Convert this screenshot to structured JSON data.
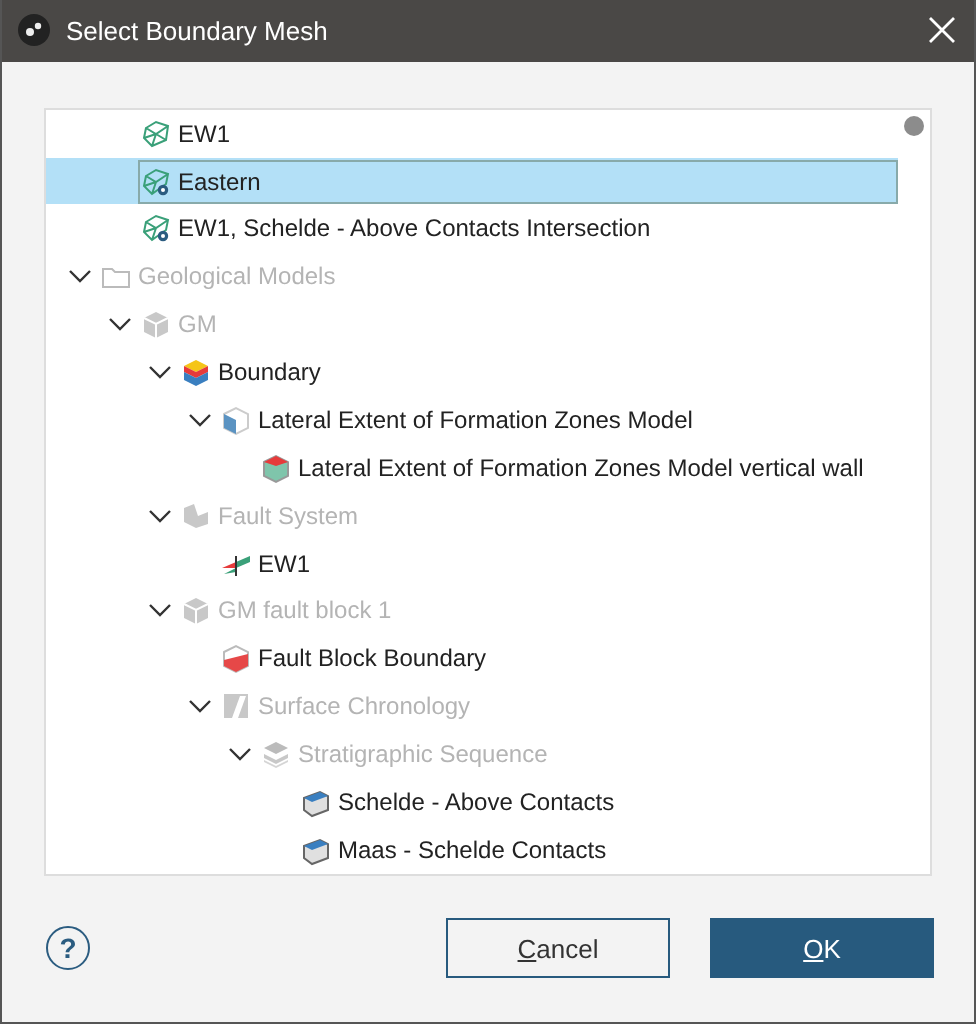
{
  "window": {
    "title": "Select Boundary Mesh"
  },
  "tree": {
    "continued_items": [
      {
        "label": "EW1",
        "kind": "mesh",
        "selected": false,
        "disabled": false
      },
      {
        "label": "Eastern",
        "kind": "mesh-gear",
        "selected": true,
        "disabled": false
      },
      {
        "label": "EW1, Schelde - Above Contacts Intersection",
        "kind": "mesh-gear",
        "selected": false,
        "disabled": false
      }
    ],
    "items": [
      {
        "label": "Geological Models",
        "kind": "folder",
        "selected": false,
        "disabled": true,
        "expanded": true,
        "children": [
          {
            "label": "GM",
            "kind": "model",
            "selected": false,
            "disabled": true,
            "expanded": true,
            "children": [
              {
                "label": "Boundary",
                "kind": "boundary",
                "selected": false,
                "disabled": false,
                "expanded": true,
                "children": [
                  {
                    "label": "Lateral Extent of Formation Zones Model",
                    "kind": "lateral",
                    "selected": false,
                    "disabled": false,
                    "expanded": true,
                    "children": [
                      {
                        "label": "Lateral Extent of Formation Zones Model vertical wall",
                        "kind": "wall",
                        "selected": false,
                        "disabled": false
                      }
                    ]
                  }
                ]
              },
              {
                "label": "Fault System",
                "kind": "fault-system",
                "selected": false,
                "disabled": true,
                "expanded": true,
                "children": [
                  {
                    "label": "EW1",
                    "kind": "fault",
                    "selected": false,
                    "disabled": false
                  }
                ]
              },
              {
                "label": "GM fault block 1",
                "kind": "model",
                "selected": false,
                "disabled": true,
                "expanded": true,
                "children": [
                  {
                    "label": "Fault Block Boundary",
                    "kind": "block-boundary",
                    "selected": false,
                    "disabled": false
                  },
                  {
                    "label": "Surface Chronology",
                    "kind": "chronology",
                    "selected": false,
                    "disabled": true,
                    "expanded": true,
                    "children": [
                      {
                        "label": "Stratigraphic Sequence",
                        "kind": "sequence",
                        "selected": false,
                        "disabled": true,
                        "expanded": true,
                        "children": [
                          {
                            "label": "Schelde - Above Contacts",
                            "kind": "contact",
                            "selected": false,
                            "disabled": false
                          },
                          {
                            "label": "Maas - Schelde Contacts",
                            "kind": "contact",
                            "selected": false,
                            "disabled": false
                          }
                        ]
                      }
                    ]
                  }
                ]
              }
            ]
          }
        ]
      }
    ]
  },
  "footer": {
    "help": "?",
    "buttons": [
      {
        "label": "Cancel",
        "kind": "secondary"
      },
      {
        "label": "OK",
        "kind": "primary"
      }
    ]
  }
}
